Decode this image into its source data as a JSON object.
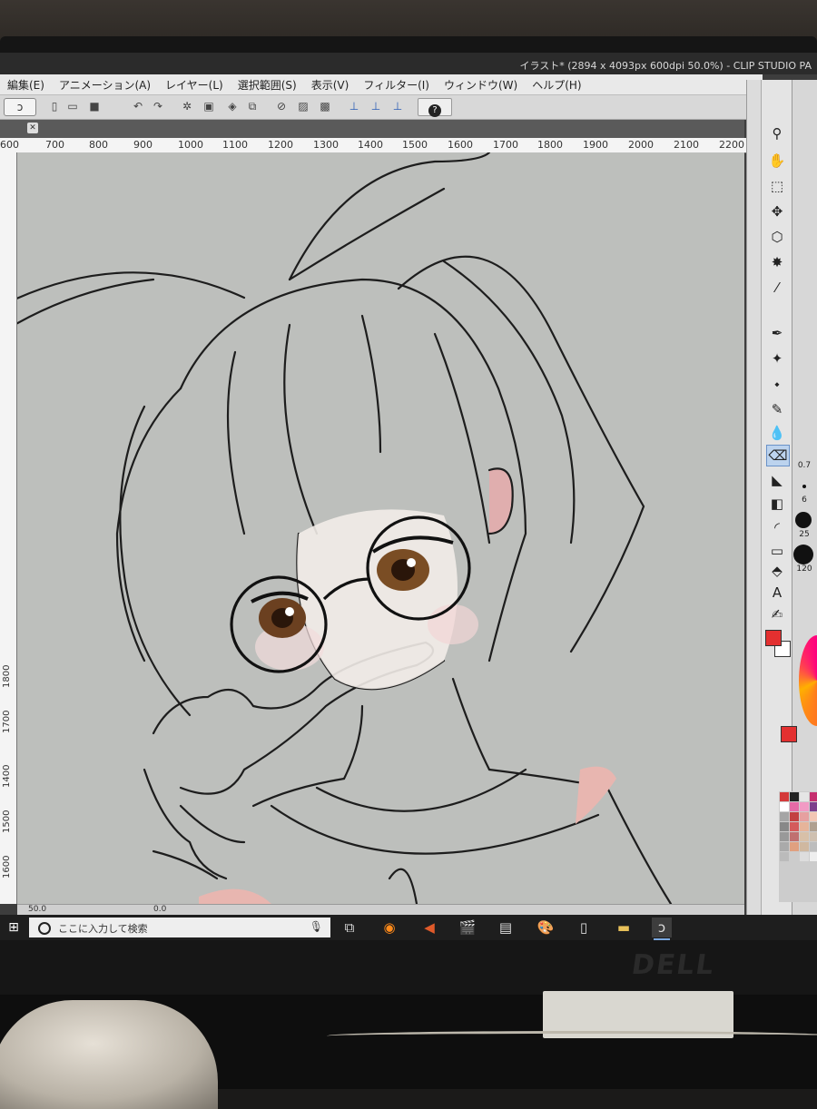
{
  "app": {
    "window_title": "イラスト* (2894 x 4093px 600dpi 50.0%) - CLIP STUDIO PA"
  },
  "menu": {
    "items": [
      "編集(E)",
      "アニメーション(A)",
      "レイヤー(L)",
      "選択範囲(S)",
      "表示(V)",
      "フィルター(I)",
      "ウィンドウ(W)",
      "ヘルプ(H)"
    ]
  },
  "toolbar": {
    "help_icon": "?"
  },
  "ruler": {
    "horizontal": [
      "600",
      "700",
      "800",
      "900",
      "1000",
      "1100",
      "1200",
      "1300",
      "1400",
      "1500",
      "1600",
      "1700",
      "1800",
      "1900",
      "2000",
      "2100",
      "2200"
    ],
    "vertical": [
      "1400",
      "1500",
      "1600",
      "1700",
      "1800"
    ]
  },
  "status": {
    "zoom": "50.0",
    "value": "0.0"
  },
  "brush_sizes": [
    "0.7",
    "6",
    "25",
    "120"
  ],
  "colors": {
    "main": "#e33030",
    "canvas": "#bdbfbc",
    "accent": "#2a5db5"
  },
  "palette_colors": [
    "#d43a3a",
    "#222222",
    "#e5e5e5",
    "#c52f6f",
    "#ffffff",
    "#e66aa6",
    "#f19ac4",
    "#7d3f8c",
    "#a5a5a5",
    "#c34141",
    "#e6a0a0",
    "#f2c6b4",
    "#888888",
    "#d45b5b",
    "#e6b49a",
    "#b0a090",
    "#999999",
    "#c07070",
    "#d8c0a8",
    "#cfc0b0",
    "#aaaaaa",
    "#e0a080",
    "#d0b8a0",
    "#bdbdbd",
    "#bbbbbb",
    "#cccccc",
    "#dddddd",
    "#eeeeee"
  ],
  "taskbar": {
    "search_placeholder": "ここに入力して検索",
    "icons": [
      "task-view-icon",
      "firefox-icon",
      "speaker-icon",
      "movie-maker-icon",
      "film-icon",
      "paint-icon",
      "file-icon",
      "folder-icon",
      "clip-studio-icon"
    ]
  },
  "monitor": {
    "brand": "DELL"
  }
}
